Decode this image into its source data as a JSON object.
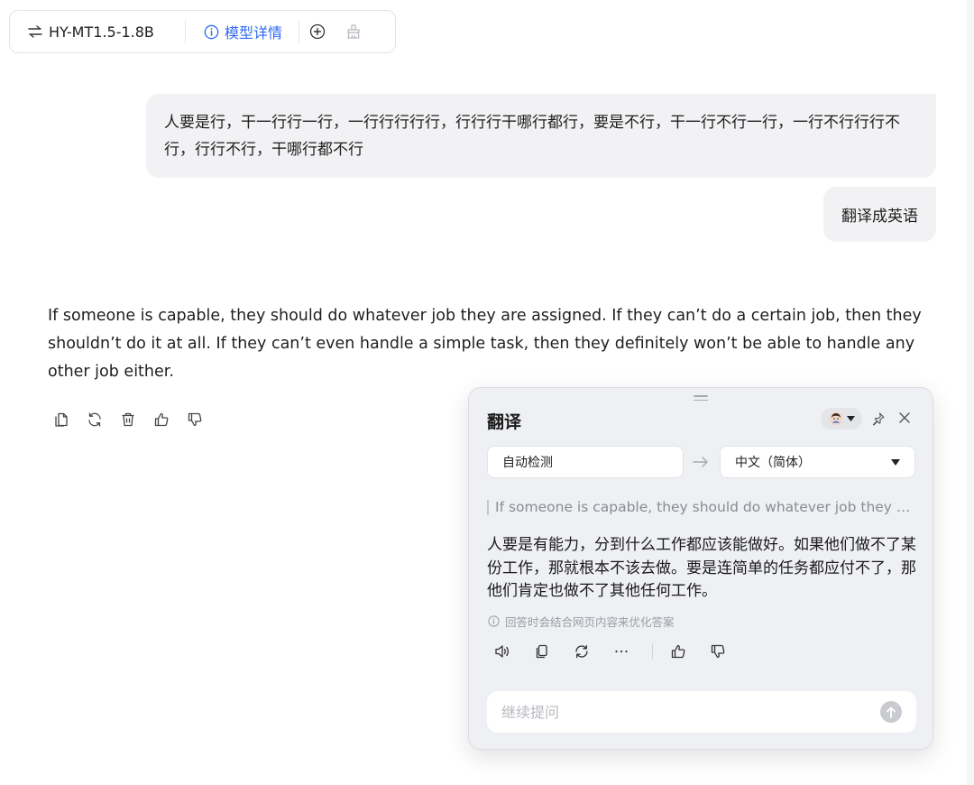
{
  "toolbar": {
    "model_name": "HY-MT1.5-1.8B",
    "model_detail_label": "模型详情",
    "icons": [
      "swap-icon",
      "info-icon",
      "add-circle-icon",
      "broom-icon"
    ]
  },
  "conversation": {
    "user_message": "人要是行，干一行行一行，一行行行行行，行行行干哪行都行，要是不行，干一行不行一行，一行不行行行不行，行行不行，干哪行都不行",
    "user_command": "翻译成英语",
    "assistant_answer": "If someone is capable, they should do whatever job they are assigned. If they can’t do a certain job, then they shouldn’t do it at all. If they can’t even handle a simple task, then they definitely won’t be able to handle any other job either.",
    "answer_actions": [
      "copy-icon",
      "regenerate-icon",
      "delete-icon",
      "thumbs-up-icon",
      "thumbs-down-icon"
    ]
  },
  "translate_panel": {
    "title": "翻译",
    "source_language": "自动检测",
    "target_language": "中文（简体）",
    "source_text": "If someone is capable, they should do whatever job they are assigned. If they can’t do a certain job, then they shouldn’t do it at all.",
    "result_text": "人要是有能力，分到什么工作都应该能做好。如果他们做不了某份工作，那就根本不该去做。要是连简单的任务都应付不了，那他们肯定也做不了其他任何工作。",
    "note": "回答时会结合网页内容来优化答案",
    "actions": [
      "speaker-icon",
      "copy-icon",
      "refresh-icon",
      "more-icon",
      "thumbs-up-icon",
      "thumbs-down-icon"
    ],
    "followup_placeholder": "继续提问"
  },
  "colors": {
    "accent": "#2f6af6",
    "bubble_bg": "#f2f2f4",
    "panel_bg": "#eff0f3"
  }
}
